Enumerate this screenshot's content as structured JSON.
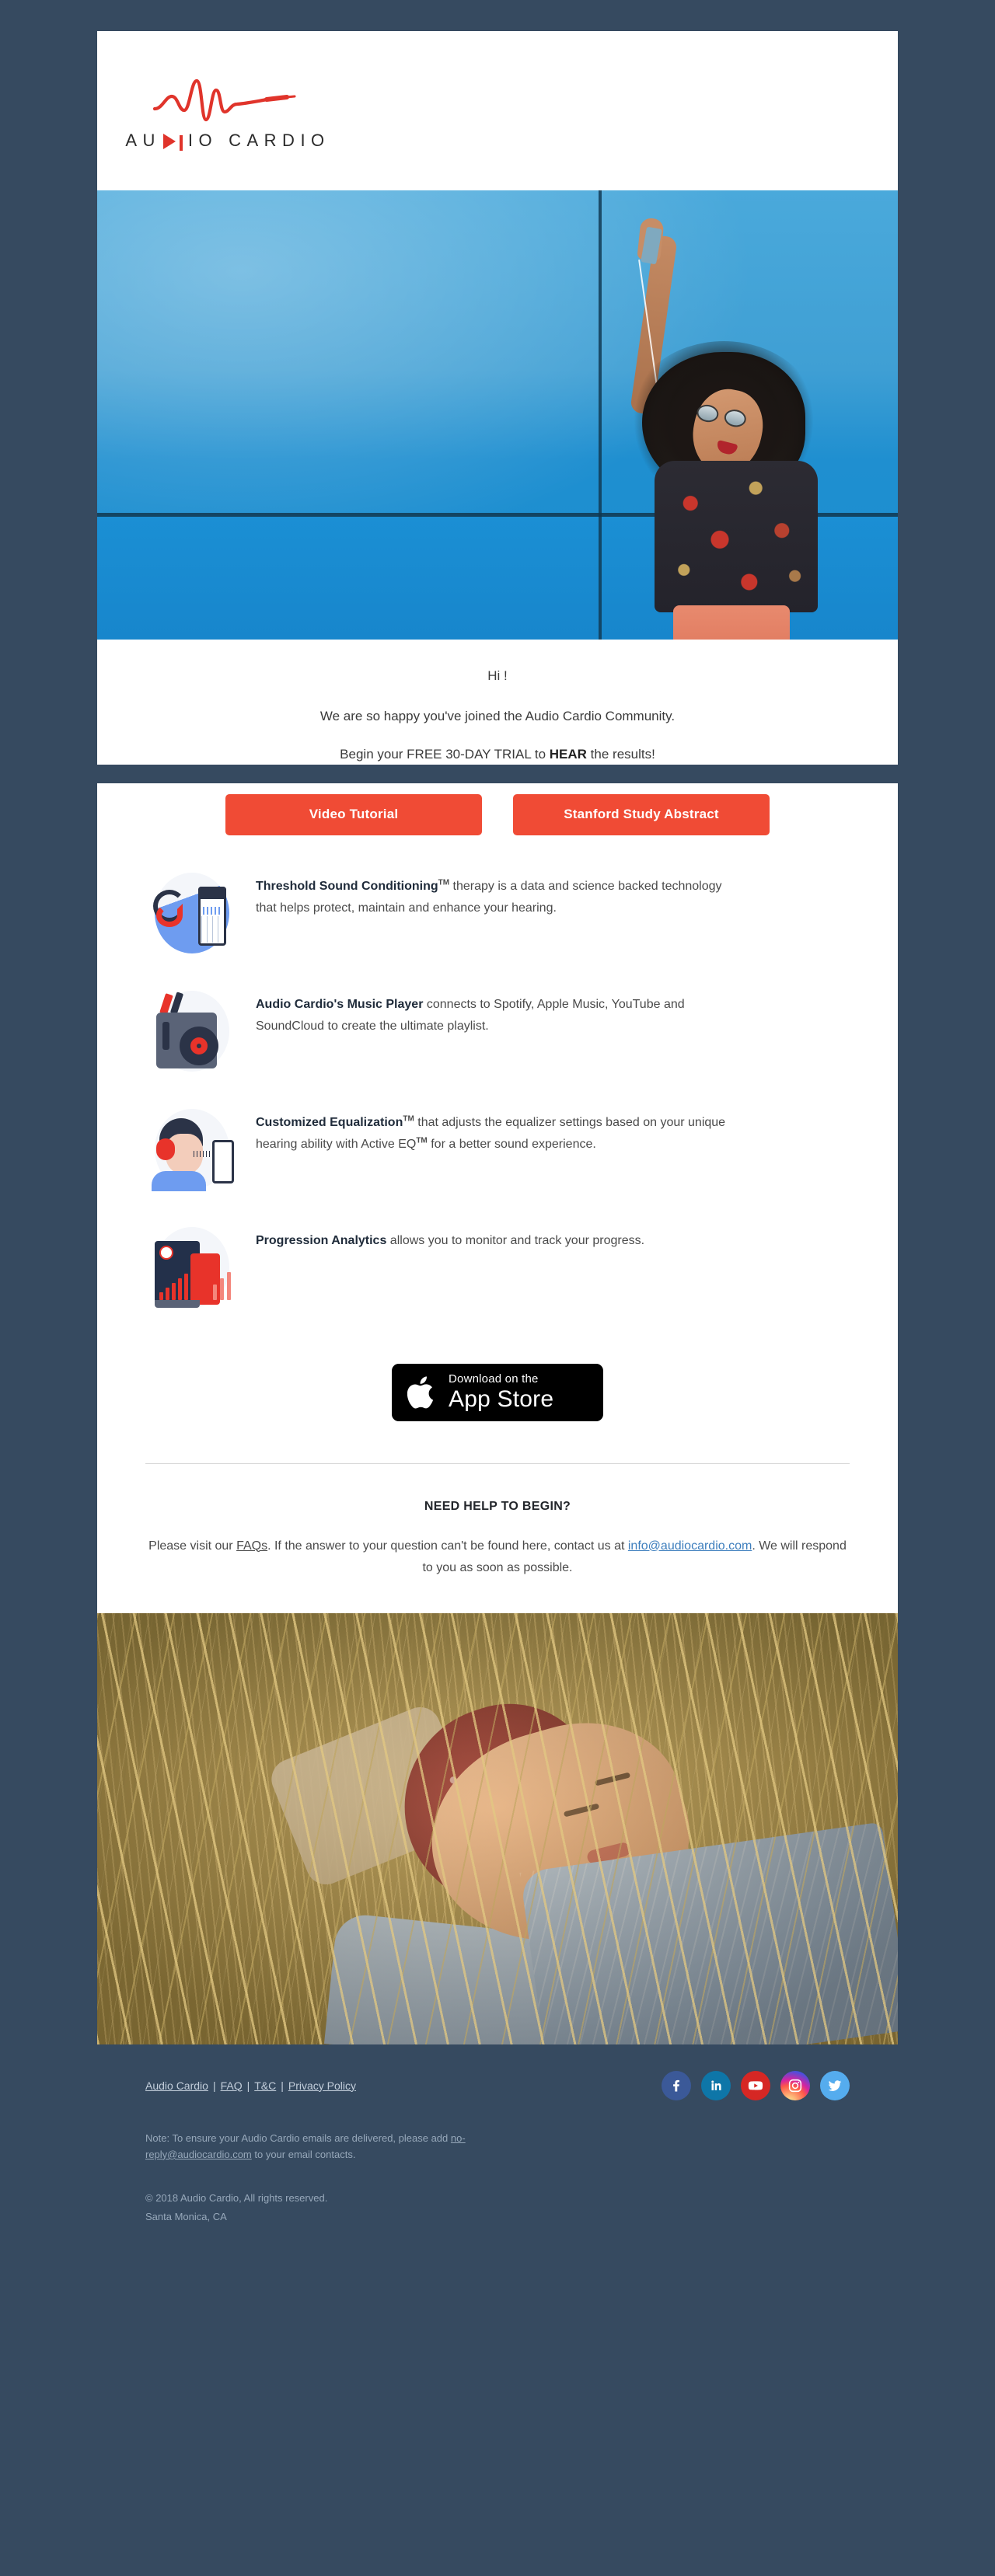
{
  "brand": {
    "name_parts": [
      "AU",
      "IO",
      "CARDIO"
    ],
    "logo_alt": "audio-cardio-waveform-logo",
    "accent_red": "#e0342b",
    "button_red": "#f04b35",
    "footer_navy": "#364a60"
  },
  "hero": {
    "alt": "woman-with-afro-listening-to-earbuds-against-blue-wall"
  },
  "intro": {
    "greeting": "Hi !",
    "line1": "We are so happy you've joined the Audio Cardio Community.",
    "line2_pre": "Begin your FREE 30-DAY TRIAL  to ",
    "line2_bold": "HEAR",
    "line2_post": " the results!"
  },
  "cta": {
    "video_tutorial": "Video Tutorial",
    "stanford_study": "Stanford Study Abstract"
  },
  "features": [
    {
      "icon": "headphones-phone-icon",
      "title": "Threshold Sound Conditioning",
      "tm": "TM",
      "body": " therapy is a data and science backed technology that helps protect, maintain and enhance your hearing."
    },
    {
      "icon": "record-player-icon",
      "title": "Audio Cardio's Music Player",
      "tm": "",
      "body": " connects to Spotify, Apple Music, YouTube and SoundCloud to create the ultimate playlist."
    },
    {
      "icon": "person-headphones-phone-icon",
      "title": "Customized Equalization",
      "tm": "TM",
      "body": " that adjusts the equalizer settings based on your unique hearing ability with Active EQ",
      "body2_tm": "TM",
      "body2": " for a better sound experience."
    },
    {
      "icon": "analytics-chart-icon",
      "title": "Progression Analytics",
      "tm": "",
      "body": " allows you to monitor and track your progress."
    }
  ],
  "appstore": {
    "line1": "Download on the",
    "line2": "App Store",
    "icon": "apple-logo-icon"
  },
  "help": {
    "heading": "NEED HELP TO BEGIN?",
    "text_pre": "Please visit our ",
    "faq_link": "FAQs",
    "text_mid": ". If the answer to your question can't be found here, contact us at ",
    "email_link": "info@audiocardio.com",
    "text_post": ". We will respond to you as soon as possible."
  },
  "photo2": {
    "alt": "woman-in-bandana-lying-in-tall-grass-at-sunset"
  },
  "footer": {
    "links": [
      {
        "label": "Audio Cardio"
      },
      {
        "label": "FAQ"
      },
      {
        "label": "T&C"
      },
      {
        "label": "Privacy Policy"
      }
    ],
    "separator": "|",
    "socials": [
      {
        "name": "facebook-icon",
        "label": "f"
      },
      {
        "name": "linkedin-icon",
        "label": "in"
      },
      {
        "name": "youtube-icon",
        "label": "▶"
      },
      {
        "name": "instagram-icon",
        "label": "▢"
      },
      {
        "name": "twitter-icon",
        "label": "ᵕ"
      }
    ],
    "note_pre": "Note: To ensure your Audio Cardio emails are delivered, please add ",
    "note_email": "no-reply@audiocardio.com",
    "note_post": " to your email contacts.",
    "copyright": "© 2018 Audio Cardio, All rights reserved.",
    "city": "Santa Monica, CA"
  }
}
